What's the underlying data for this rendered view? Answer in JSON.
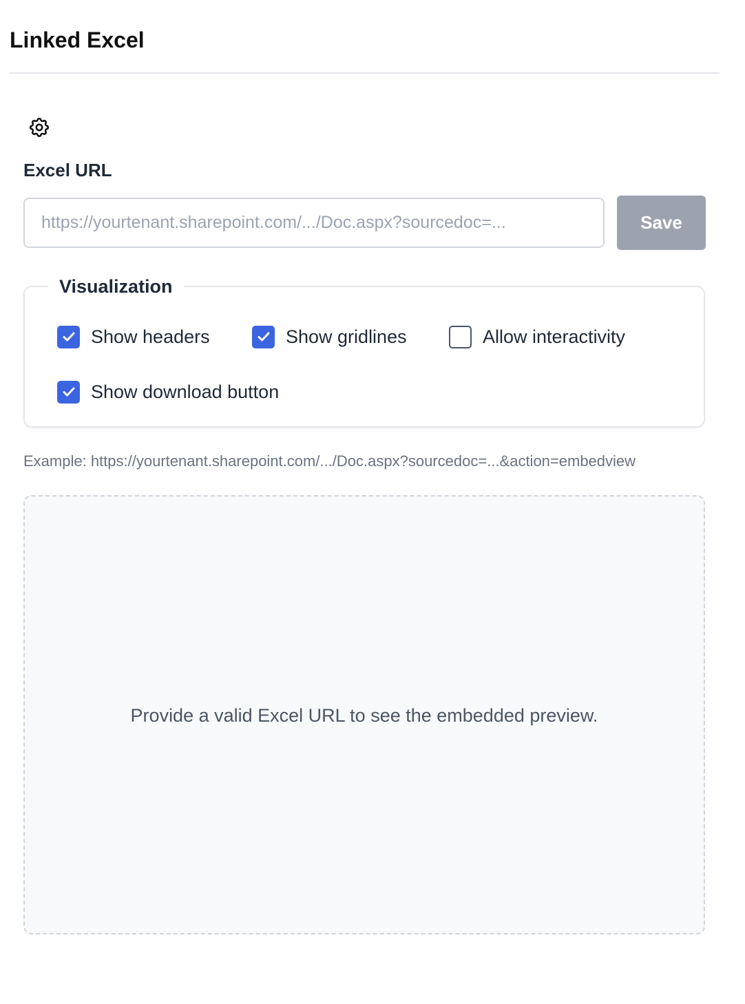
{
  "header": {
    "title": "Linked Excel"
  },
  "settings": {
    "icon": "gear-icon"
  },
  "url_field": {
    "label": "Excel URL",
    "value": "",
    "placeholder": "https://yourtenant.sharepoint.com/.../Doc.aspx?sourcedoc=..."
  },
  "save_button": {
    "label": "Save",
    "disabled_color": "#9ca3af"
  },
  "visualization": {
    "legend": "Visualization",
    "options": [
      {
        "label": "Show headers",
        "checked": true
      },
      {
        "label": "Show gridlines",
        "checked": true
      },
      {
        "label": "Allow interactivity",
        "checked": false
      },
      {
        "label": "Show download button",
        "checked": true
      }
    ],
    "accent_color": "#3b64e0"
  },
  "example": {
    "text": "Example: https://yourtenant.sharepoint.com/.../Doc.aspx?sourcedoc=...&action=embedview"
  },
  "preview": {
    "message": "Provide a valid Excel URL to see the embedded preview."
  }
}
